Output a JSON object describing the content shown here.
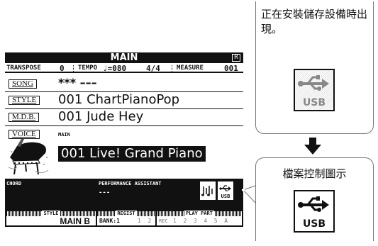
{
  "lcd": {
    "title": "MAIN",
    "corner_badge": "R",
    "status": {
      "transpose_label": "TRANSPOSE",
      "transpose_value": "0",
      "tempo_label": "TEMPO",
      "tempo_value": "♩=080",
      "time_signature": "4/4",
      "measure_label": "MEASURE",
      "measure_value": "001"
    },
    "song": {
      "tag": "SONG",
      "value": "*** –––"
    },
    "style": {
      "tag": "STYLE",
      "value": "001 ChartPianoPop"
    },
    "mdb": {
      "tag": "M.D.B.",
      "value": "001 Jude Hey"
    },
    "voice": {
      "tag": "VOICE",
      "sub_label": "MAIN",
      "value": "001 Live! Grand Piano"
    },
    "performance": {
      "chord_label": "CHORD",
      "assistant_label": "PERFORMANCE ASSISTANT",
      "assistant_value": "---"
    },
    "bottom": {
      "style_header": "STYLE",
      "style_value": "MAIN B",
      "regist_header": "REGIST",
      "bank_label": "BANK:1",
      "regist_nums": "1  2",
      "playpart_header": "PLAY PART",
      "rec_label": "REC",
      "playpart_tracks": "1  2  3  4  5  A"
    },
    "icons": {
      "metronome_icon": "music-notes-icon",
      "usb_icon": "usb-icon",
      "usb_text": "USB"
    }
  },
  "callouts": {
    "installing_text": "正在安裝儲存設備時出現。",
    "control_text": "檔案控制圖示",
    "usb_text": "USB"
  }
}
